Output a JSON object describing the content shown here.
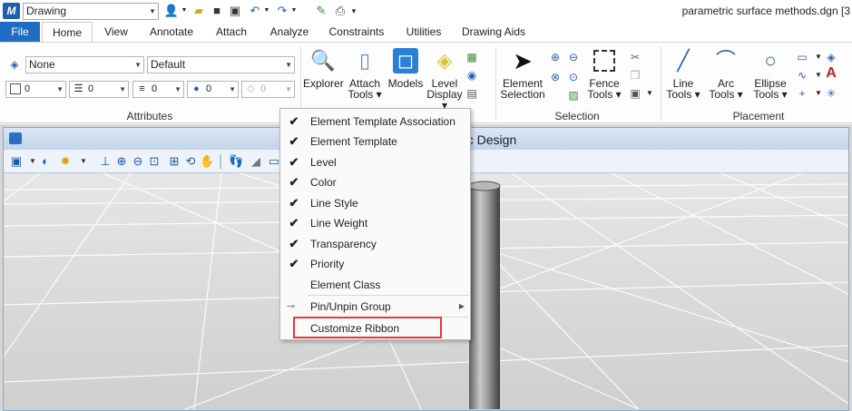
{
  "title_bar": {
    "workflow": "Drawing",
    "window_title": "parametric surface methods.dgn [3",
    "quick_access_icons": [
      "user-icon",
      "folder-open-icon",
      "save-icon",
      "save-settings-icon",
      "undo-icon",
      "redo-icon",
      "pin-icon",
      "print-icon",
      "more-icon"
    ]
  },
  "tabs": [
    {
      "label": "File"
    },
    {
      "label": "Home"
    },
    {
      "label": "View"
    },
    {
      "label": "Annotate"
    },
    {
      "label": "Attach"
    },
    {
      "label": "Analyze"
    },
    {
      "label": "Constraints"
    },
    {
      "label": "Utilities"
    },
    {
      "label": "Drawing Aids"
    }
  ],
  "attributes": {
    "level": "None",
    "template": "Default",
    "color": "0",
    "line_style": "0",
    "line_weight": "0",
    "transparency": "0",
    "priority": "0",
    "group_label": "Attributes"
  },
  "home_buttons": {
    "explorer": "Explorer",
    "attach_tools": [
      "Attach",
      "Tools ▾"
    ],
    "models": "Models",
    "level_display": [
      "Level",
      "Display ▾"
    ],
    "element_selection": [
      "Element",
      "Selection"
    ],
    "fence_tools": [
      "Fence",
      "Tools ▾"
    ],
    "selection_label": "Selection",
    "line_tools": [
      "Line",
      "Tools ▾"
    ],
    "arc_tools": [
      "Arc",
      "Tools ▾"
    ],
    "ellipse_tools": [
      "Ellipse",
      "Tools ▾"
    ],
    "placement_label": "Placement"
  },
  "view": {
    "title": "ric Design"
  },
  "context_menu": {
    "items": [
      {
        "label": "Element Template Association",
        "checked": true
      },
      {
        "label": "Element Template",
        "checked": true
      },
      {
        "label": "Level",
        "checked": true
      },
      {
        "label": "Color",
        "checked": true
      },
      {
        "label": "Line Style",
        "checked": true
      },
      {
        "label": "Line Weight",
        "checked": true
      },
      {
        "label": "Transparency",
        "checked": true
      },
      {
        "label": "Priority",
        "checked": true
      },
      {
        "label": "Element Class",
        "checked": false
      }
    ],
    "pin_group": "Pin/Unpin Group",
    "customize": "Customize Ribbon",
    "check_glyph": "✔"
  },
  "colors": {
    "file_tab": "#1f6dc2",
    "accent": "#1f5fb0",
    "highlight": "#e23b3b"
  }
}
